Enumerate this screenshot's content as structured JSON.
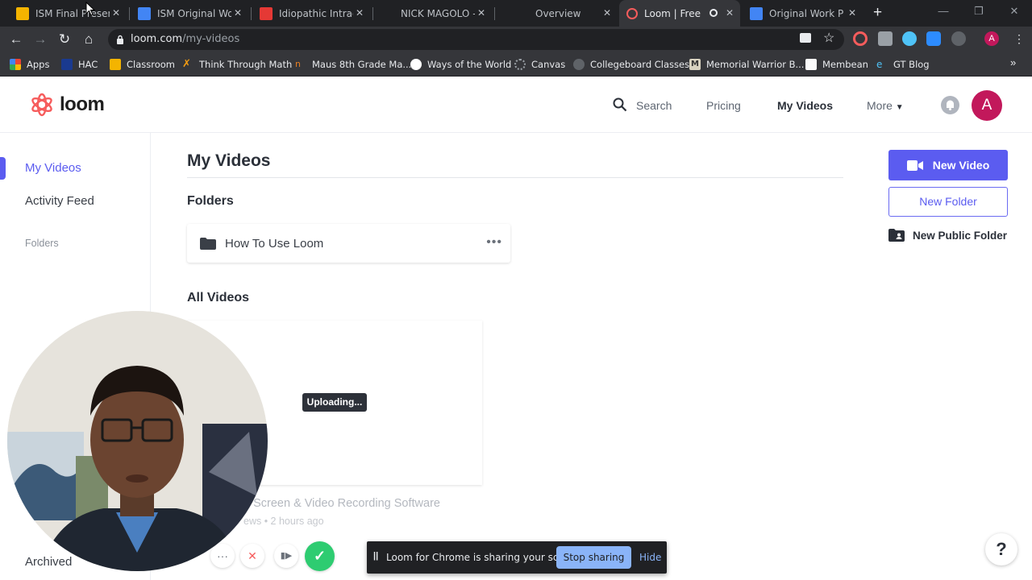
{
  "browser": {
    "tabs": [
      {
        "title": "ISM Final Presentation",
        "icon_color": "#f4b400",
        "icon": "slides-icon"
      },
      {
        "title": "ISM Original Work",
        "icon_color": "#4285f4",
        "icon": "docs-icon"
      },
      {
        "title": "Idiopathic Intracranial",
        "icon_color": "#e53935",
        "icon": "image-icon"
      },
      {
        "title": "NICK MAGOLO - I",
        "icon_color": "#202124",
        "icon": "blank-icon"
      },
      {
        "title": "Overview",
        "icon_color": "#202124",
        "icon": "blank-icon"
      },
      {
        "title": "Loom | Free Sc",
        "icon_color": "#f65c5c",
        "icon": "loom-icon",
        "active": true
      },
      {
        "title": "Original Work Pro",
        "icon_color": "#4285f4",
        "icon": "classroom-icon"
      }
    ],
    "new_tab": "+",
    "url_host": "loom.com",
    "url_path": "/my-videos",
    "bookmarks": [
      {
        "label": "Apps",
        "icon_color": "#ea4335"
      },
      {
        "label": "HAC",
        "icon_color": "#1a3a8f"
      },
      {
        "label": "Classroom",
        "icon_color": "#f4b400"
      },
      {
        "label": "Think Through Math",
        "icon_color": "#f39c12"
      },
      {
        "label": "Maus 8th Grade Ma...",
        "icon_color": "#e67e22"
      },
      {
        "label": "Ways of the World",
        "icon_color": "#ffffff"
      },
      {
        "label": "Canvas",
        "icon_color": "#35363a"
      },
      {
        "label": "Collegeboard Classes",
        "icon_color": "#202124"
      },
      {
        "label": "Memorial Warrior B...",
        "icon_color": "#d8d2c0"
      },
      {
        "label": "Membean",
        "icon_color": "#fbfbfb"
      },
      {
        "label": "GT Blog",
        "icon_color": "#35363a"
      }
    ],
    "profile_initial": "A"
  },
  "header": {
    "logo_text": "loom",
    "search_label": "Search",
    "pricing_label": "Pricing",
    "my_videos_label": "My Videos",
    "more_label": "More",
    "avatar_initial": "A"
  },
  "sidebar": {
    "items": [
      {
        "label": "My Videos"
      },
      {
        "label": "Activity Feed"
      }
    ],
    "folders_label": "Folders",
    "archived_label": "Archived"
  },
  "main": {
    "title": "My Videos",
    "folders_heading": "Folders",
    "folder_name": "How To Use Loom",
    "folder_more": "•••",
    "all_videos_heading": "All Videos",
    "uploading_label": "Uploading...",
    "video_title": "e Screen & Video Recording Software",
    "video_meta": "ews • 2 hours ago"
  },
  "actions": {
    "new_video": "New Video",
    "new_folder": "New Folder",
    "new_public_folder": "New Public Folder"
  },
  "recording_controls": {
    "more": "···",
    "cancel": "✕",
    "pause": "▮▶",
    "done": "✓"
  },
  "share_bar": {
    "pause_icon": "||",
    "text": "Loom for Chrome is sharing your screen.",
    "stop_label": "Stop sharing",
    "hide_label": "Hide"
  },
  "help_label": "?",
  "colors": {
    "accent": "#5b5cf0",
    "loom_logo": "#f65c5c",
    "avatar": "#c2185b",
    "done_green": "#2ecc71"
  }
}
